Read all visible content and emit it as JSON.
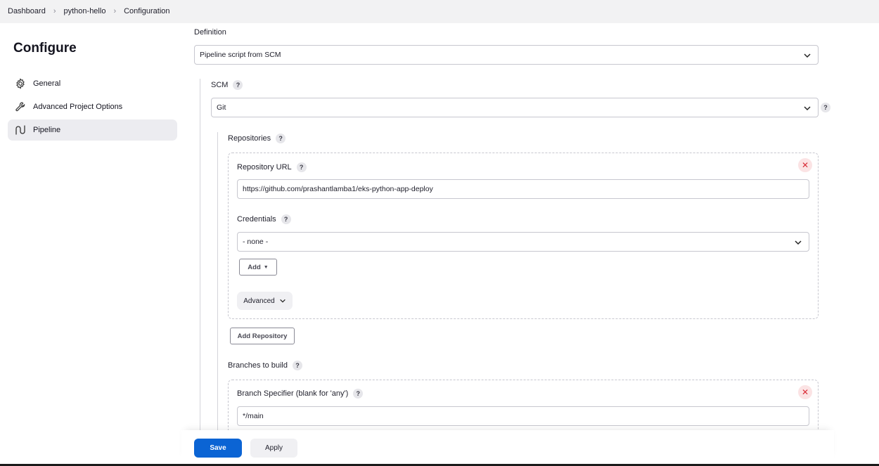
{
  "breadcrumb": [
    "Dashboard",
    "python-hello",
    "Configuration"
  ],
  "sidebar": {
    "title": "Configure",
    "items": [
      {
        "label": "General",
        "icon": "gear-icon"
      },
      {
        "label": "Advanced Project Options",
        "icon": "wrench-icon"
      },
      {
        "label": "Pipeline",
        "icon": "pipeline-icon",
        "active": true
      }
    ]
  },
  "pipeline": {
    "definition_label": "Definition",
    "definition_value": "Pipeline script from SCM",
    "scm_label": "SCM",
    "scm_value": "Git",
    "repositories_label": "Repositories",
    "repository": {
      "url_label": "Repository URL",
      "url_value": "https://github.com/prashantlamba1/eks-python-app-deploy",
      "credentials_label": "Credentials",
      "credentials_value": "- none -",
      "add_label": "Add",
      "advanced_label": "Advanced",
      "remove_icon": "close-icon"
    },
    "add_repository_label": "Add Repository",
    "branches_label": "Branches to build",
    "branch": {
      "specifier_label": "Branch Specifier (blank for 'any')",
      "specifier_value": "*/main"
    },
    "help_glyph": "?"
  },
  "footer": {
    "save_label": "Save",
    "apply_label": "Apply"
  },
  "colors": {
    "primary": "#0b64d4",
    "danger": "#d92b36",
    "active_nav": "#ececf0"
  }
}
